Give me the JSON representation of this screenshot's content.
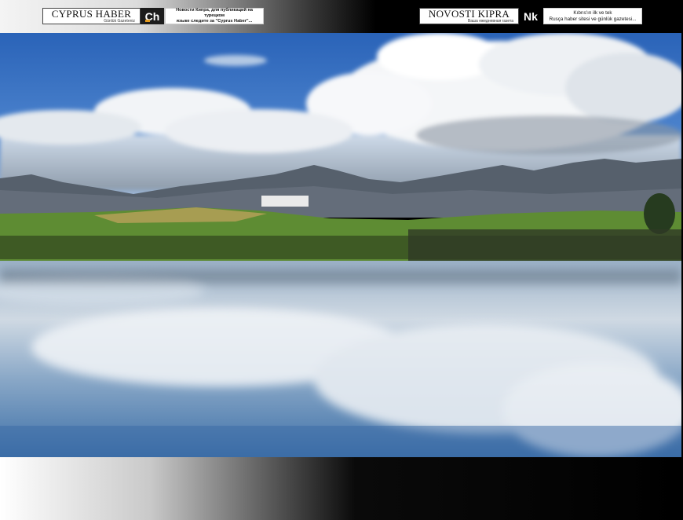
{
  "banner": {
    "left": {
      "brand_name": "CYPRUS HABER",
      "brand_tagline": "Günlük Gazeteniz",
      "logo_letters": "Ch",
      "promo_line1": "Новости Кипра, для публикаций на турецком",
      "promo_line2": "языке следите за \"Cyprus Haber\"..."
    },
    "right": {
      "brand_name": "NOVOSTI KIPRA",
      "brand_tagline": "Ваша ежедневная газета",
      "logo_letters": "Nk",
      "promo_line1": "Kıbrıs'ın ilk ve tek",
      "promo_line2": "Rusça haber sitesi ve günlük gazetesi..."
    }
  },
  "photo": {
    "subject": "landscape-lake-mountains-clouds",
    "colors": {
      "sky": "#2f6fc2",
      "cloud": "#f2f4f6",
      "mountain": "#4c5561",
      "grass": "#5a8a2e",
      "water": "#7f9fc0"
    }
  }
}
